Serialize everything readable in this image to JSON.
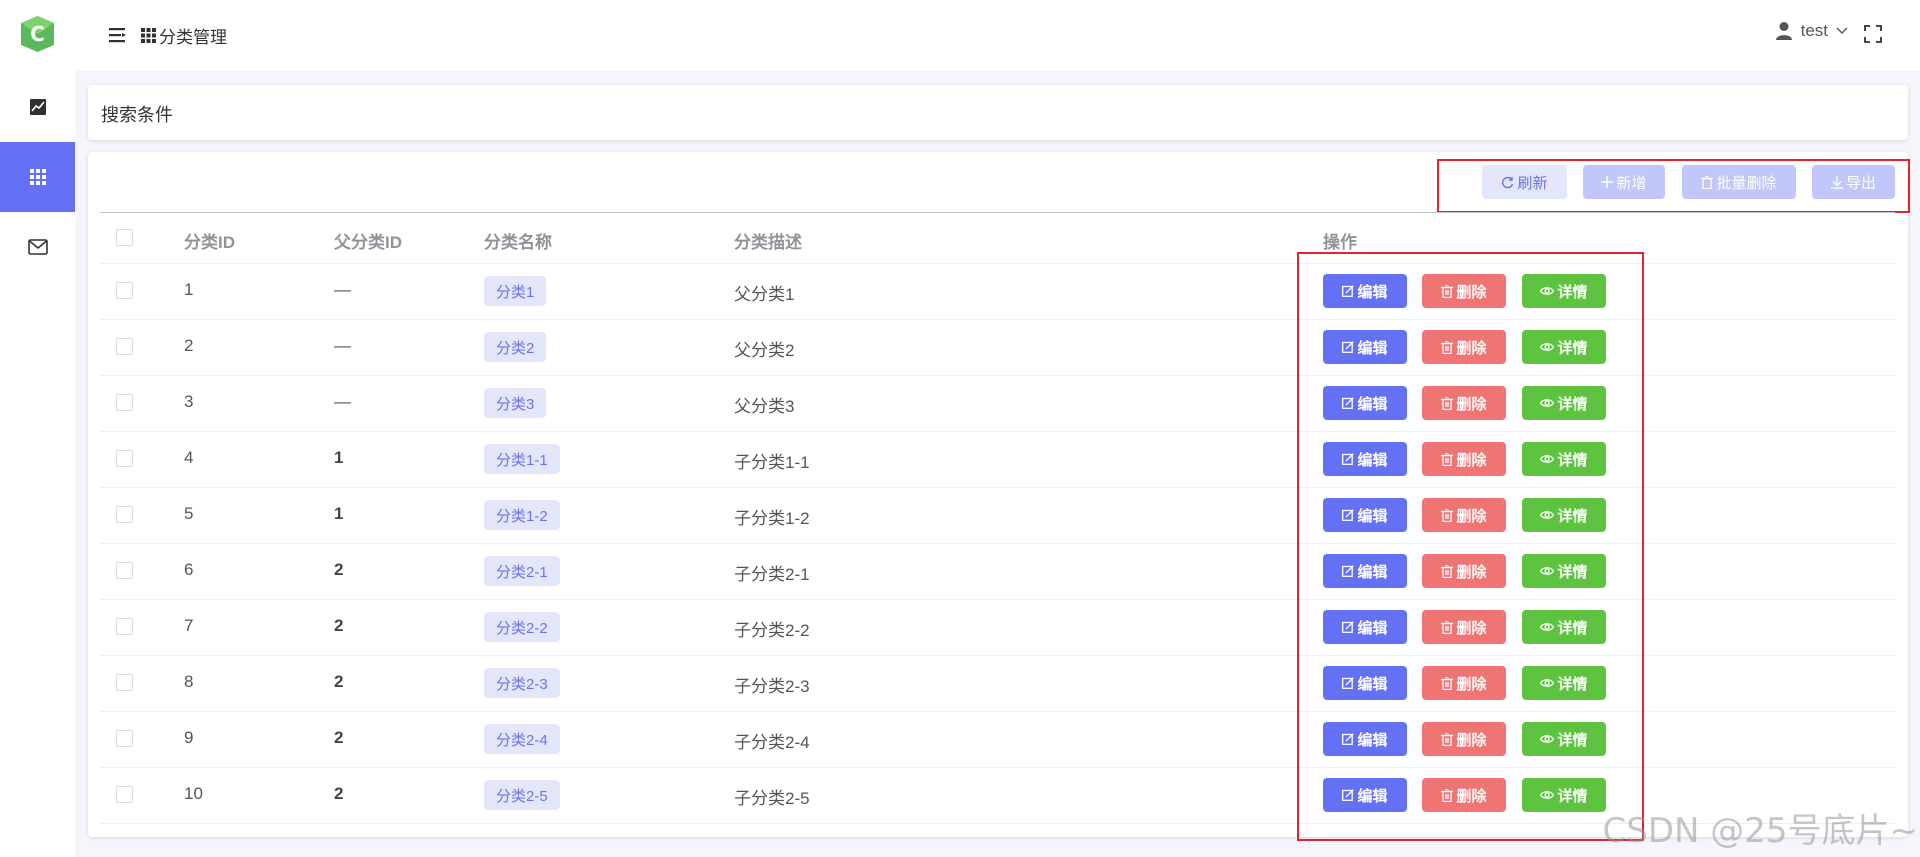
{
  "header": {
    "title": "分类管理",
    "username": "test"
  },
  "search": {
    "title": "搜索条件"
  },
  "toolbar": {
    "refresh": "刷新",
    "add": "新增",
    "batch_delete": "批量删除",
    "export": "导出"
  },
  "table": {
    "columns": [
      "分类ID",
      "父分类ID",
      "分类名称",
      "分类描述",
      "操作"
    ],
    "rows": [
      {
        "id": "1",
        "parent": "—",
        "name": "分类1",
        "desc": "父分类1"
      },
      {
        "id": "2",
        "parent": "—",
        "name": "分类2",
        "desc": "父分类2"
      },
      {
        "id": "3",
        "parent": "—",
        "name": "分类3",
        "desc": "父分类3"
      },
      {
        "id": "4",
        "parent": "1",
        "name": "分类1-1",
        "desc": "子分类1-1"
      },
      {
        "id": "5",
        "parent": "1",
        "name": "分类1-2",
        "desc": "子分类1-2"
      },
      {
        "id": "6",
        "parent": "2",
        "name": "分类2-1",
        "desc": "子分类2-1"
      },
      {
        "id": "7",
        "parent": "2",
        "name": "分类2-2",
        "desc": "子分类2-2"
      },
      {
        "id": "8",
        "parent": "2",
        "name": "分类2-3",
        "desc": "子分类2-3"
      },
      {
        "id": "9",
        "parent": "2",
        "name": "分类2-4",
        "desc": "子分类2-4"
      },
      {
        "id": "10",
        "parent": "2",
        "name": "分类2-5",
        "desc": "子分类2-5"
      }
    ],
    "actions": {
      "edit": "编辑",
      "delete": "删除",
      "detail": "详情"
    }
  },
  "watermark": "CSDN @25号底片~",
  "colors": {
    "primary": "#6571f5",
    "danger": "#f07474",
    "success": "#5ec340",
    "highlight_box": "#e0262c"
  },
  "icons": {
    "logo": "c-logo-icon",
    "dashboard": "chart-icon",
    "category": "grid-icon",
    "message": "mail-icon"
  }
}
